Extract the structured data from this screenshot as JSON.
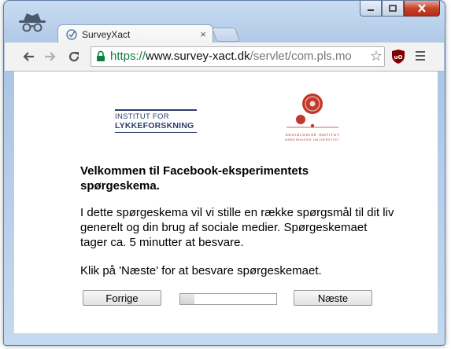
{
  "browser": {
    "tab_title": "SurveyXact",
    "url_scheme": "https://",
    "url_host": "www.survey-xact.dk",
    "url_path": "/servlet/com.pls.mo",
    "tab_close_glyph": "×",
    "star_glyph": "☆",
    "icons": [
      "incognito-icon",
      "minimize-icon",
      "maximize-icon",
      "close-icon",
      "back-icon",
      "forward-icon",
      "reload-icon",
      "lock-icon",
      "bookmark-star-icon",
      "ublock-icon",
      "menu-icon"
    ]
  },
  "logos": {
    "left_line1": "INSTITUT FOR",
    "left_line2": "LYKKEFORSKNING",
    "right_caption1": "SOCIOLOGISK INSTITUT",
    "right_caption2": "KØBENHAVNS UNIVERSITET"
  },
  "survey": {
    "heading": "Velkommen til Facebook-eksperimentets spørgeskema.",
    "intro": "I dette spørgeskema vil vi stille en række spørgsmål til dit liv generelt og din brug af sociale medier. Spørgeskemaet tager ca. 5 minutter at besvare.",
    "instruction": "Klik på 'Næste' for at besvare spørgeskemaet.",
    "prev_label": "Forrige",
    "next_label": "Næste",
    "progress_fraction": 0.15
  },
  "colors": {
    "url_scheme": "#0b8043",
    "logo_blue": "#2b3e6e",
    "logo_red": "#c0392b"
  }
}
